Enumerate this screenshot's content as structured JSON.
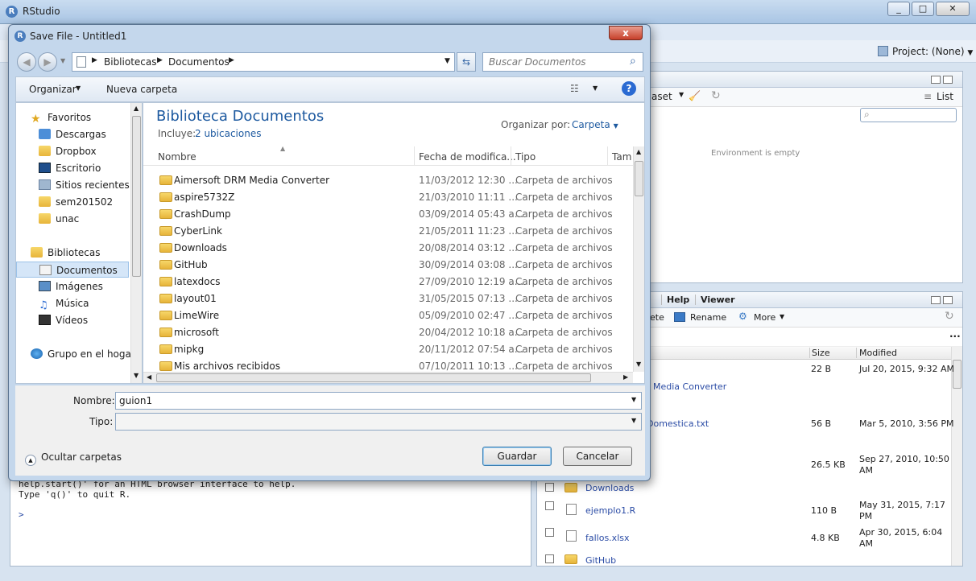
{
  "rstudio": {
    "title": "RStudio",
    "project": "Project: (None)",
    "env": {
      "dataset_btn": "aset",
      "list": "List",
      "empty": "Environment is empty"
    },
    "files": {
      "tabs": [
        "Help",
        "Viewer"
      ],
      "actions": {
        "delete": "ete",
        "rename": "Rename",
        "more": "More"
      },
      "headers": {
        "size": "Size",
        "modified": "Modified"
      },
      "rows": [
        {
          "name": "",
          "size": "22 B",
          "modified": "Jul 20, 2015, 9:32 AM"
        },
        {
          "name": "Media Converter",
          "size": "",
          "modified": ""
        },
        {
          "name": "Domestica.txt",
          "size": "56 B",
          "modified": "Mar 5, 2010, 3:56 PM"
        },
        {
          "name": "",
          "size": "26.5 KB",
          "modified": "Sep 27, 2010, 10:50 AM"
        },
        {
          "name": "Downloads",
          "size": "",
          "modified": ""
        },
        {
          "name": "ejemplo1.R",
          "size": "110 B",
          "modified": "May 31, 2015, 7:17 PM"
        },
        {
          "name": "fallos.xlsx",
          "size": "4.8 KB",
          "modified": "Apr 30, 2015, 6:04 AM"
        },
        {
          "name": "GitHub",
          "size": "",
          "modified": ""
        }
      ]
    },
    "console": {
      "line1": "help.start()' for an HTML browser interface to help.",
      "line2": "Type 'q()' to quit R.",
      "prompt": ">"
    }
  },
  "dialog": {
    "title": "Save File - Untitled1",
    "close": "x",
    "breadcrumb": [
      "Bibliotecas",
      "Documentos"
    ],
    "search_placeholder": "Buscar Documentos",
    "toolbar": {
      "organize": "Organizar",
      "new_folder": "Nueva carpeta"
    },
    "nav": {
      "favorites_header": "Favoritos",
      "favorites": [
        "Descargas",
        "Dropbox",
        "Escritorio",
        "Sitios recientes",
        "sem201502",
        "unac"
      ],
      "libraries_header": "Bibliotecas",
      "libraries": [
        "Documentos",
        "Imágenes",
        "Música",
        "Vídeos"
      ],
      "homegroup": "Grupo en el hogar"
    },
    "library": {
      "title": "Biblioteca Documentos",
      "includes_label": "Incluye:",
      "includes_link": "2 ubicaciones",
      "arrange_label": "Organizar por:",
      "arrange_value": "Carpeta"
    },
    "columns": {
      "name": "Nombre",
      "date": "Fecha de modifica...",
      "type": "Tipo",
      "size": "Tam"
    },
    "rows": [
      {
        "name": "Aimersoft DRM Media Converter",
        "date": "11/03/2012 12:30 ...",
        "type": "Carpeta de archivos"
      },
      {
        "name": "aspire5732Z",
        "date": "21/03/2010 11:11 ...",
        "type": "Carpeta de archivos"
      },
      {
        "name": "CrashDump",
        "date": "03/09/2014 05:43 a...",
        "type": "Carpeta de archivos"
      },
      {
        "name": "CyberLink",
        "date": "21/05/2011 11:23 ...",
        "type": "Carpeta de archivos"
      },
      {
        "name": "Downloads",
        "date": "20/08/2014 03:12 ...",
        "type": "Carpeta de archivos"
      },
      {
        "name": "GitHub",
        "date": "30/09/2014 03:08 ...",
        "type": "Carpeta de archivos"
      },
      {
        "name": "latexdocs",
        "date": "27/09/2010 12:19 a...",
        "type": "Carpeta de archivos"
      },
      {
        "name": "layout01",
        "date": "31/05/2015 07:13 ...",
        "type": "Carpeta de archivos"
      },
      {
        "name": "LimeWire",
        "date": "05/09/2010 02:47 ...",
        "type": "Carpeta de archivos"
      },
      {
        "name": "microsoft",
        "date": "20/04/2012 10:18 a...",
        "type": "Carpeta de archivos"
      },
      {
        "name": "mipkg",
        "date": "20/11/2012 07:54 a...",
        "type": "Carpeta de archivos"
      },
      {
        "name": "Mis archivos recibidos",
        "date": "07/10/2011 10:13 ...",
        "type": "Carpeta de archivos"
      }
    ],
    "filename_label": "Nombre:",
    "filename_value": "guion1",
    "type_label": "Tipo:",
    "type_value": "",
    "hide_folders": "Ocultar carpetas",
    "save": "Guardar",
    "cancel": "Cancelar"
  }
}
